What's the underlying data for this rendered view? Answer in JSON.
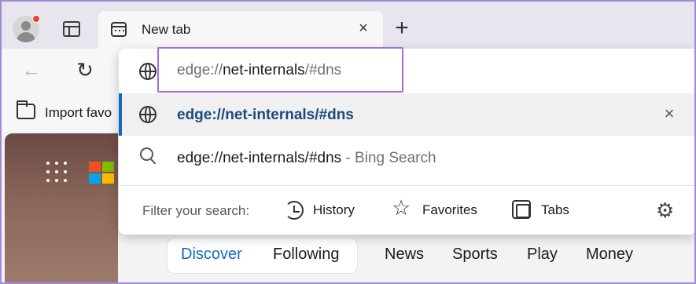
{
  "tabstrip": {
    "tab_title": "New tab",
    "close_glyph": "×",
    "new_tab_glyph": "+"
  },
  "toolbar": {
    "back_glyph": "←",
    "refresh_glyph": "↻"
  },
  "favorites_bar": {
    "import_label": "Import favo"
  },
  "omnibox": {
    "address_prefix": "edge://",
    "address_host": "net-internals",
    "address_suffix": "/#dns",
    "suggestions": [
      {
        "text": "edge://net-internals/#dns",
        "icon": "globe-icon",
        "selected": true
      },
      {
        "text": "edge://net-internals/#dns",
        "suffix": "Bing Search",
        "separator": " - ",
        "icon": "search-icon"
      }
    ],
    "remove_glyph": "×",
    "filter_label": "Filter your search:",
    "filters": [
      {
        "label": "History",
        "icon": "history-icon"
      },
      {
        "label": "Favorites",
        "icon": "star-icon"
      },
      {
        "label": "Tabs",
        "icon": "tabs-icon"
      }
    ],
    "star_glyph": "☆",
    "settings_glyph": "⚙"
  },
  "ntp_nav": {
    "items": [
      "Discover",
      "Following",
      "News",
      "Sports",
      "Play",
      "Money"
    ],
    "active": "Discover"
  },
  "colors": {
    "accent": "#0f6cbd",
    "highlight_border": "#a36fe0",
    "profile_badge": "#e2442f",
    "ms_logo": [
      "#f25022",
      "#7fba00",
      "#00a4ef",
      "#ffb900"
    ]
  }
}
